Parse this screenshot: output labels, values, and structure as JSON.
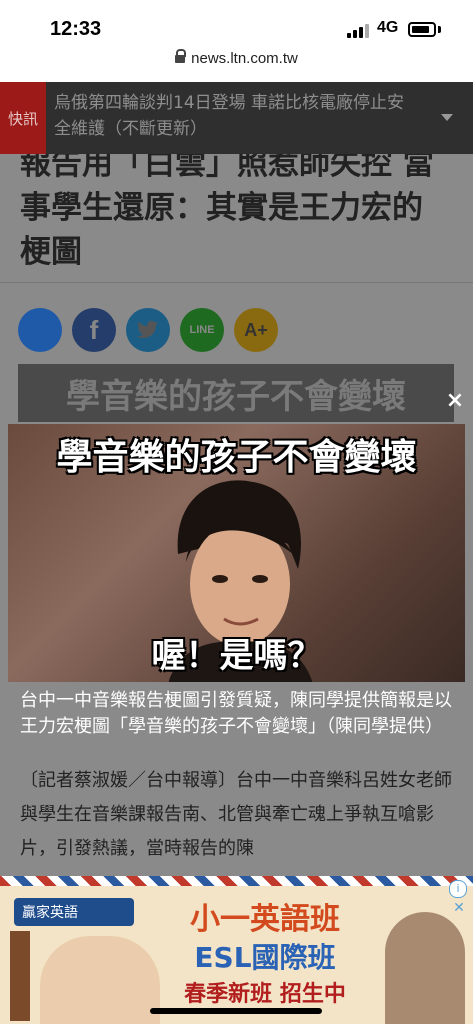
{
  "status_bar": {
    "time": "12:33",
    "network": "4G"
  },
  "browser": {
    "url": "news.ltn.com.tw"
  },
  "breaking": {
    "label": "快訊",
    "text": "烏俄第四輪談判14日登場 車諾比核電廠停止安全維護（不斷更新）"
  },
  "article": {
    "headline": "報告用「白雲」照惹師失控 當事學生還原：其實是王力宏的梗圖",
    "share_buttons": [
      "",
      "f",
      "",
      "LINE",
      "A+"
    ],
    "bg_banner_text": "學音樂的孩子不會變壞",
    "image": {
      "top_text": "學音樂的孩子不會變壞",
      "bottom_text": "喔！是嗎？",
      "caption": "台中一中音樂報告梗圖引發質疑，陳同學提供簡報是以王力宏梗圖「學音樂的孩子不會變壞」（陳同學提供）"
    },
    "body": "〔記者蔡淑媛／台中報導〕台中一中音樂科呂姓女老師與學生在音樂課報告南、北管與牽亡魂上爭執互嗆影片，引發熱議，當時報告的陳"
  },
  "overlay": {
    "close_label": "×"
  },
  "ad": {
    "brand": "贏家英語",
    "line1": "小一英語班",
    "line2": "ESL國際班",
    "line3": "春季新班 招生中",
    "info_label": "i",
    "close_label": "✕"
  },
  "colors": {
    "breaking_red": "#9c1a17",
    "facebook": "#3b5998",
    "twitter": "#1da1f2",
    "line": "#00b900",
    "font_btn": "#f0b400"
  }
}
